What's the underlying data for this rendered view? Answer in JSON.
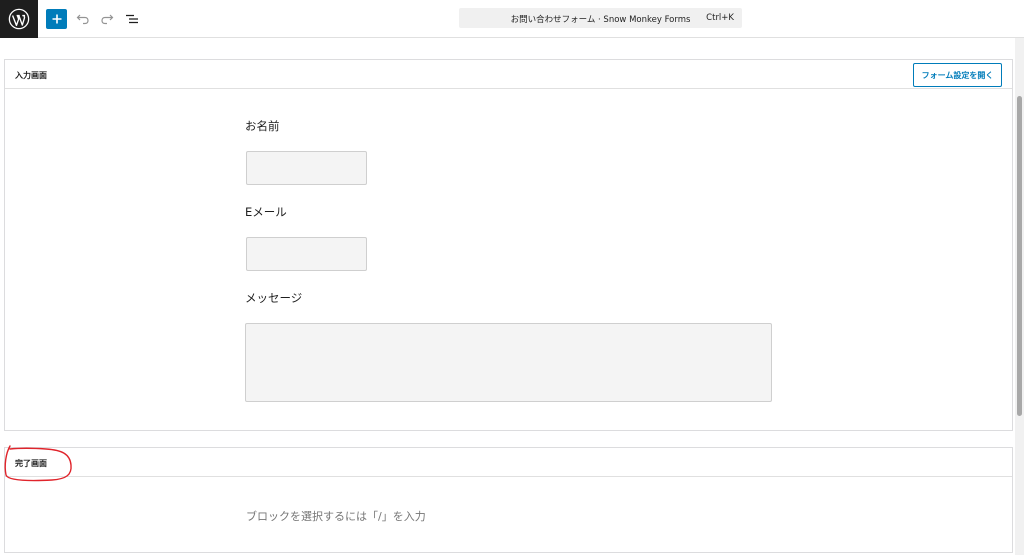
{
  "toolbar": {
    "logo_icon": "wordpress-logo",
    "add_icon": "plus-icon",
    "undo_icon": "undo-icon",
    "redo_icon": "redo-icon",
    "list_view_icon": "list-view-icon",
    "command_bar_title": "お問い合わせフォーム · Snow Monkey Forms",
    "command_bar_shortcut": "Ctrl+K"
  },
  "input_screen": {
    "title": "入力画面",
    "settings_button_label": "フォーム設定を開く",
    "fields": [
      {
        "label": "お名前",
        "type": "text",
        "value": ""
      },
      {
        "label": "Eメール",
        "type": "email",
        "value": ""
      },
      {
        "label": "メッセージ",
        "type": "textarea",
        "value": ""
      }
    ]
  },
  "complete_screen": {
    "title": "完了画面",
    "block_placeholder": "ブロックを選択するには「/」を入力"
  },
  "colors": {
    "accent": "#007cba",
    "annotation": "#e0242b",
    "logo_bg": "#1e1e1e"
  }
}
